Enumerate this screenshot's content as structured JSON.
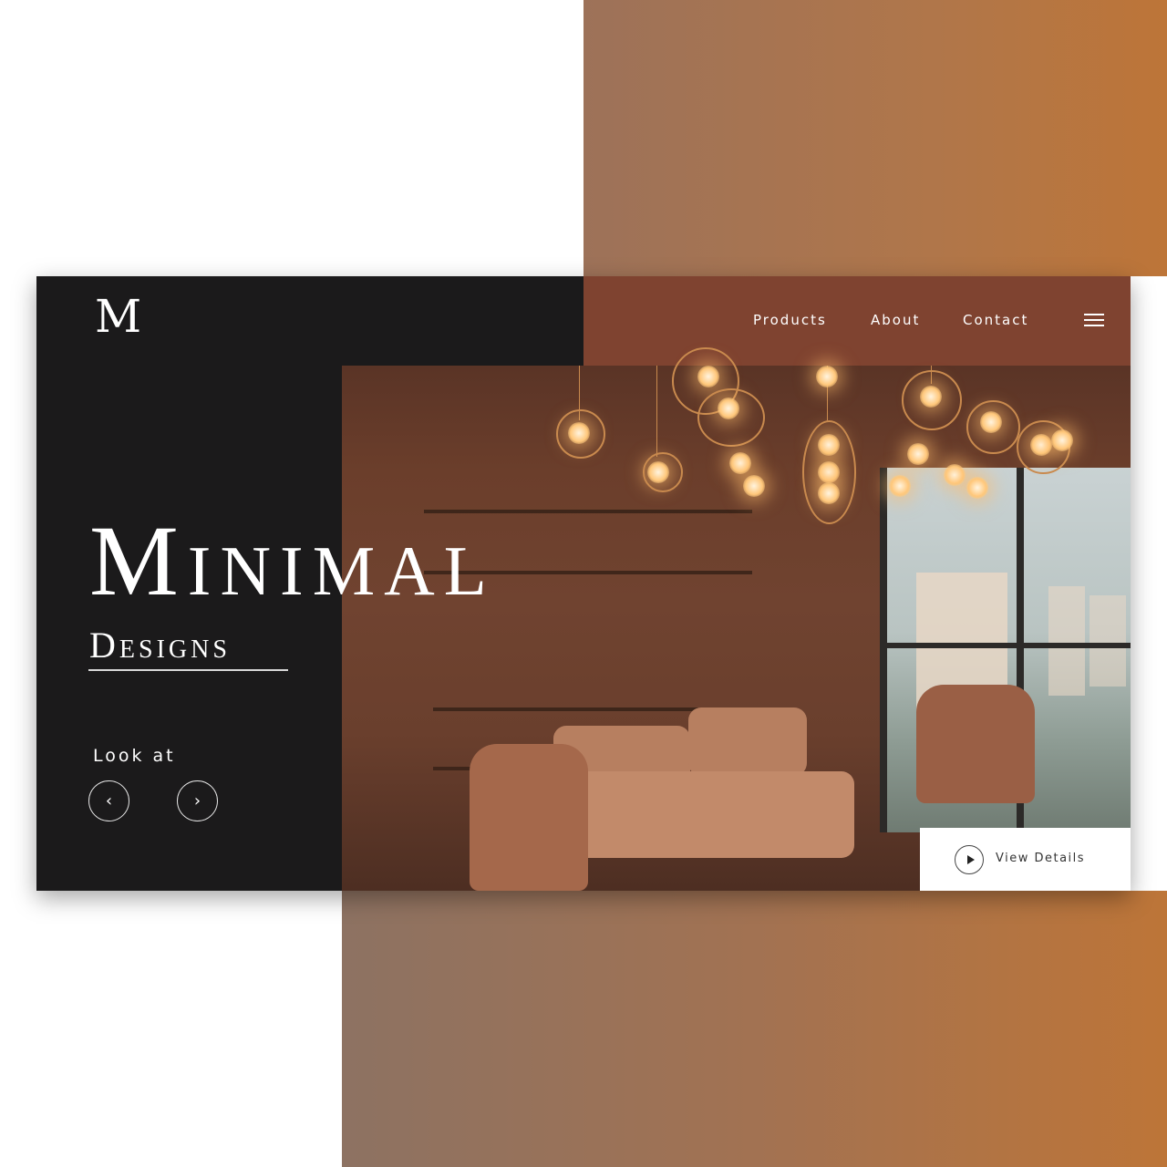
{
  "brand": {
    "logo": "M"
  },
  "nav": {
    "items": [
      {
        "label": "Products"
      },
      {
        "label": "About"
      },
      {
        "label": "Contact"
      }
    ],
    "menu_icon": "hamburger-icon"
  },
  "hero": {
    "title": "Minimal",
    "subtitle": "Designs",
    "prompt": "Look at",
    "prev_icon": "chevron-left-icon",
    "next_icon": "chevron-right-icon",
    "prev_glyph": "‹",
    "next_glyph": "›"
  },
  "cta": {
    "label": "View Details",
    "icon": "play-icon"
  },
  "colors": {
    "dark_panel": "#1b1a1b",
    "rust_panel": "#7f4330",
    "accent_gradient_start": "#9d7259",
    "accent_gradient_end": "#bd7538",
    "text_light": "#ffffff"
  }
}
